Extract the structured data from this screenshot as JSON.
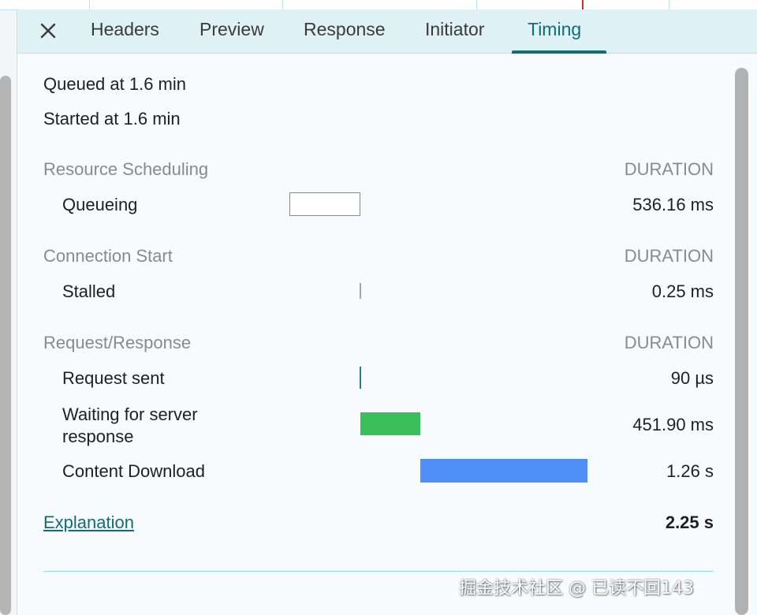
{
  "tabs": {
    "items": [
      "Headers",
      "Preview",
      "Response",
      "Initiator",
      "Timing"
    ],
    "active": "Timing"
  },
  "icons": {
    "close": "close-icon"
  },
  "meta": {
    "queued": "Queued at 1.6 min",
    "started": "Started at 1.6 min"
  },
  "sections": {
    "scheduling": {
      "title": "Resource Scheduling",
      "duration_header": "DURATION",
      "rows": [
        {
          "label": "Queueing",
          "value": "536.16 ms"
        }
      ]
    },
    "connection": {
      "title": "Connection Start",
      "duration_header": "DURATION",
      "rows": [
        {
          "label": "Stalled",
          "value": "0.25 ms"
        }
      ]
    },
    "request": {
      "title": "Request/Response",
      "duration_header": "DURATION",
      "rows": [
        {
          "label": "Request sent",
          "value": "90 µs"
        },
        {
          "label": "Waiting for server response",
          "value": "451.90 ms"
        },
        {
          "label": "Content Download",
          "value": "1.26 s"
        }
      ]
    }
  },
  "footer": {
    "explanation": "Explanation",
    "total": "2.25 s"
  },
  "colors": {
    "accent": "#0d6e78",
    "waiting": "#3bbf5c",
    "download": "#4f8ff7",
    "queue_border": "#8a8a8a",
    "tab_bg": "#dff1f4"
  },
  "watermark": "掘金技术社区 @ 已读不回143"
}
